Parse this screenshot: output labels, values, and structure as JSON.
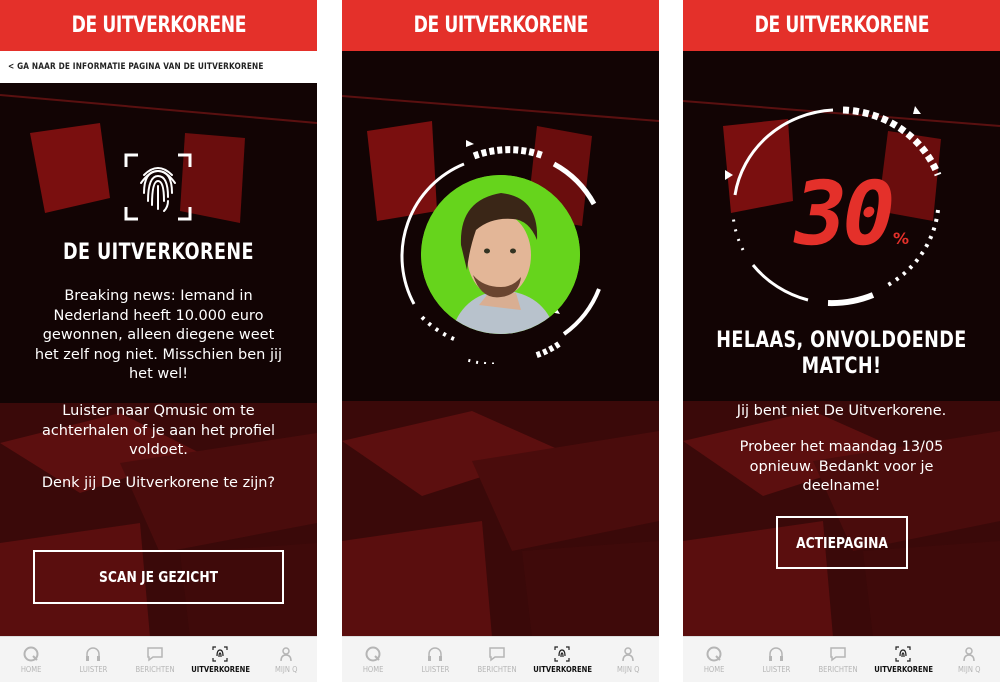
{
  "brand_color": "#e4302a",
  "app_title": "DE UITVERKORENE",
  "back_link": "< GA NAAR DE INFORMATIE PAGINA VAN DE UITVERKORENE",
  "tabs": [
    {
      "label": "HOME",
      "icon": "q-logo-icon"
    },
    {
      "label": "LUISTER",
      "icon": "headphones-icon"
    },
    {
      "label": "BERICHTEN",
      "icon": "chat-icon"
    },
    {
      "label": "UITVERKORENE",
      "icon": "fingerprint-icon",
      "active": true
    },
    {
      "label": "MIJN Q",
      "icon": "user-icon"
    }
  ],
  "screen1": {
    "heading": "DE UITVERKORENE",
    "para1": "Breaking news: Iemand in Nederland heeft 10.000 euro gewonnen, alleen diegene weet het zelf nog niet. Misschien ben jij het wel!",
    "para2": "Luister naar Qmusic om te achterhalen of je aan het profiel voldoet.",
    "para3": "Denk jij De Uitverkorene te zijn?",
    "button": "SCAN JE GEZICHT"
  },
  "screen3": {
    "percent_value": "30",
    "percent_sign": "%",
    "heading_line1": "HELAAS, ONVOLDOENDE",
    "heading_line2": "MATCH!",
    "para1": "Jij bent niet De Uitverkorene.",
    "para2": "Probeer het maandag 13/05 opnieuw. Bedankt voor je deelname!",
    "button": "ACTIEPAGINA"
  }
}
